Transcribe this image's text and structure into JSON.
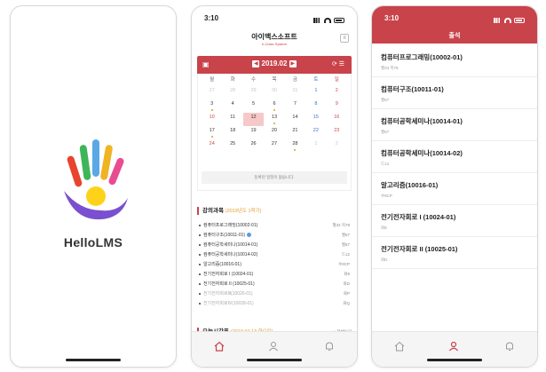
{
  "splash": {
    "app_name": "HelloLMS"
  },
  "calendar_screen": {
    "time": "3:10",
    "header_title": "아이맥스소프트",
    "header_subtitle": "e-Class System",
    "month": "2019.02",
    "weekdays": [
      "월",
      "화",
      "수",
      "목",
      "금",
      "토",
      "일"
    ],
    "days": [
      {
        "n": "27",
        "cls": "muted"
      },
      {
        "n": "28",
        "cls": "muted"
      },
      {
        "n": "29",
        "cls": "muted"
      },
      {
        "n": "30",
        "cls": "muted"
      },
      {
        "n": "31",
        "cls": "muted"
      },
      {
        "n": "1",
        "cls": "sat"
      },
      {
        "n": "2",
        "cls": "sun"
      },
      {
        "n": "3",
        "cls": "",
        "dot": true
      },
      {
        "n": "4",
        "cls": ""
      },
      {
        "n": "5",
        "cls": ""
      },
      {
        "n": "6",
        "cls": "",
        "dot": true
      },
      {
        "n": "7",
        "cls": ""
      },
      {
        "n": "8",
        "cls": "sat"
      },
      {
        "n": "9",
        "cls": "sun"
      },
      {
        "n": "10",
        "cls": "sun"
      },
      {
        "n": "11",
        "cls": ""
      },
      {
        "n": "12",
        "cls": "today"
      },
      {
        "n": "13",
        "cls": "",
        "dot": true
      },
      {
        "n": "14",
        "cls": ""
      },
      {
        "n": "15",
        "cls": "sat"
      },
      {
        "n": "16",
        "cls": "sun"
      },
      {
        "n": "17",
        "cls": "",
        "dot": true
      },
      {
        "n": "18",
        "cls": ""
      },
      {
        "n": "19",
        "cls": ""
      },
      {
        "n": "20",
        "cls": ""
      },
      {
        "n": "21",
        "cls": ""
      },
      {
        "n": "22",
        "cls": "sat"
      },
      {
        "n": "23",
        "cls": "sun"
      },
      {
        "n": "24",
        "cls": "sun"
      },
      {
        "n": "25",
        "cls": ""
      },
      {
        "n": "26",
        "cls": ""
      },
      {
        "n": "27",
        "cls": ""
      },
      {
        "n": "28",
        "cls": "",
        "dot": true
      },
      {
        "n": "1",
        "cls": "muted"
      },
      {
        "n": "2",
        "cls": "muted"
      }
    ],
    "no_schedule": "등록된 일정이 없습니다.",
    "courses_title": "강의과목",
    "courses_term": "(2019년도 1학기)",
    "courses": [
      {
        "name": "컴퓨터프로그래밍(10002-01)",
        "room": "월34 목78",
        "faded": false,
        "info": false
      },
      {
        "name": "컴퓨터구조(10011-01)",
        "room": "월67",
        "faded": false,
        "info": true
      },
      {
        "name": "컴퓨터공학세미나(10014-01)",
        "room": "월67",
        "faded": false,
        "info": false
      },
      {
        "name": "컴퓨터공학세미나(10014-02)",
        "room": "드12",
        "faded": false,
        "info": false
      },
      {
        "name": "알고리즘(10016-01)",
        "room": "수9CP",
        "faded": false,
        "info": false
      },
      {
        "name": "전기전자회로 I (10024-01)",
        "room": "화9",
        "faded": false,
        "info": false
      },
      {
        "name": "전기전자회로 II (10025-01)",
        "room": "화D",
        "faded": false,
        "info": false
      },
      {
        "name": "전기전자회로Ⅲ(10026-01)",
        "room": "화P",
        "faded": true,
        "info": false
      },
      {
        "name": "전기전자회로Ⅳ(10028-01)",
        "room": "화Q",
        "faded": true,
        "info": false
      }
    ],
    "timetable_title": "오늘시간표",
    "timetable_date": "(2019.02.13 화요일)",
    "timetable_more": "+ 전체보기"
  },
  "attendance_screen": {
    "time": "3:10",
    "title": "출석",
    "courses": [
      {
        "name": "컴퓨터프로그래밍(10002-01)",
        "sub": "월34 목78"
      },
      {
        "name": "컴퓨터구조(10011-01)",
        "sub": "월67"
      },
      {
        "name": "컴퓨터공학세미나(10014-01)",
        "sub": "월67"
      },
      {
        "name": "컴퓨터공학세미나(10014-02)",
        "sub": "드12"
      },
      {
        "name": "알고리즘(10016-01)",
        "sub": "수9CP"
      },
      {
        "name": "전기전자회로 I (10024-01)",
        "sub": "화9"
      },
      {
        "name": "전기전자회로 II (10025-01)",
        "sub": "화D"
      }
    ]
  },
  "colors": {
    "accent": "#c9434a",
    "highlight": "#e19a2b"
  },
  "icons": [
    "home-icon",
    "profile-icon",
    "bell-icon",
    "calendar-icon",
    "menu-icon"
  ]
}
